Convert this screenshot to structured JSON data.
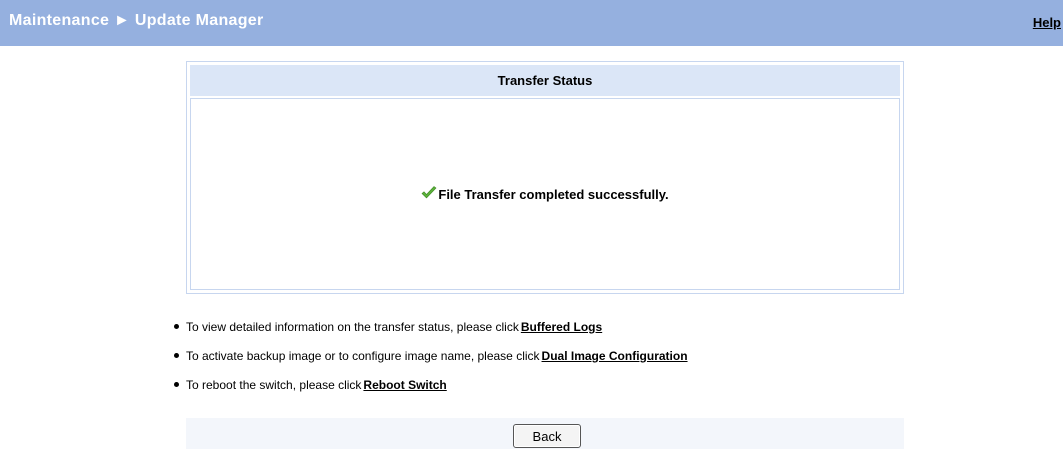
{
  "header": {
    "title": "Maintenance ► Update Manager",
    "help_label": "Help"
  },
  "status_panel": {
    "title": "Transfer Status",
    "message": "File Transfer completed successfully.",
    "icon": "checkmark-icon",
    "icon_color": "#5cb13a"
  },
  "info_items": [
    {
      "text": "To view detailed information on the transfer status, please click",
      "link": "Buffered Logs"
    },
    {
      "text": "To activate backup image or to configure image name, please click",
      "link": "Dual Image Configuration"
    },
    {
      "text": "To reboot the switch, please click",
      "link": "Reboot Switch"
    }
  ],
  "footer": {
    "back_label": "Back"
  },
  "colors": {
    "header_bg": "#95b0df",
    "panel_header_bg": "#dbe6f7",
    "panel_border": "#c7d6ef"
  }
}
